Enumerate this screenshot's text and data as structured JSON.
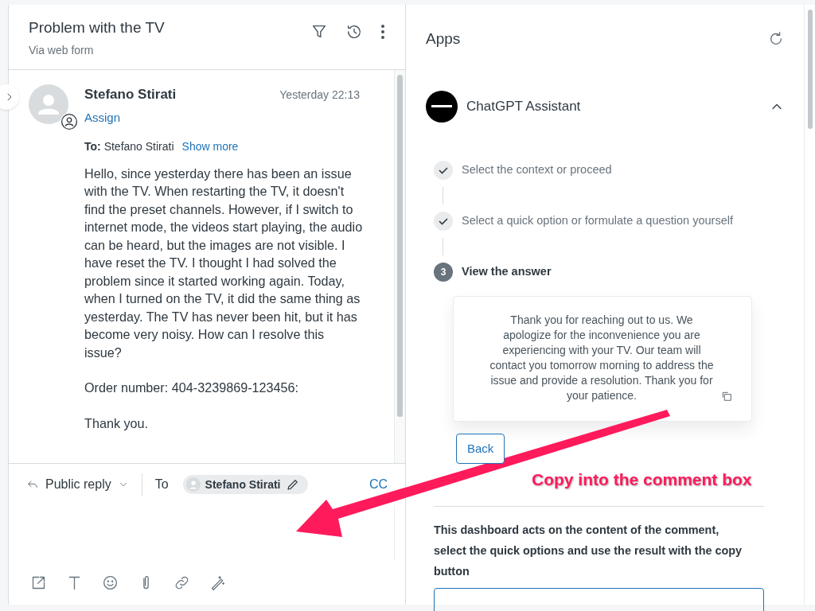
{
  "ticket": {
    "title": "Problem with the TV",
    "subtitle": "Via web form"
  },
  "message": {
    "sender": "Stefano Stirati",
    "time": "Yesterday 22:13",
    "assign": "Assign",
    "to_label": "To:",
    "to_name": "Stefano Stirati",
    "show_more": "Show more",
    "body": [
      "Hello, since yesterday there has been an issue with the TV. When restarting the TV, it doesn't find the preset channels. However, if I switch to internet mode, the videos start playing, the audio can be heard, but the images are not visible. I have reset the TV. I thought I had solved the problem since it started working again. Today, when I turned on the TV, it did the same thing as yesterday. The TV has never been hit, but it has become very noisy. How can I resolve this issue?",
      "Order number: 404-3239869-123456:",
      "Thank you."
    ]
  },
  "reply": {
    "mode": "Public reply",
    "to_label": "To",
    "recipient": "Stefano Stirati",
    "cc": "CC"
  },
  "apps": {
    "title": "Apps",
    "app": {
      "name": "ChatGPT Assistant",
      "expanded": true
    },
    "steps": [
      {
        "label": "Select the context or proceed",
        "done": true
      },
      {
        "label": "Select a quick option or formulate a question yourself",
        "done": true
      },
      {
        "label": "View the answer",
        "done": false,
        "number": "3"
      }
    ],
    "answer": "Thank you for reaching out to us. We apologize for the inconvenience you are experiencing with your TV. Our team will contact you tomorrow morning to address the issue and provide a resolution. Thank you for your patience.",
    "back": "Back",
    "description": "This dashboard acts on the content of the comment, select the quick options and use the result with the copy button"
  },
  "annotation": {
    "text": "Copy into the comment box"
  }
}
